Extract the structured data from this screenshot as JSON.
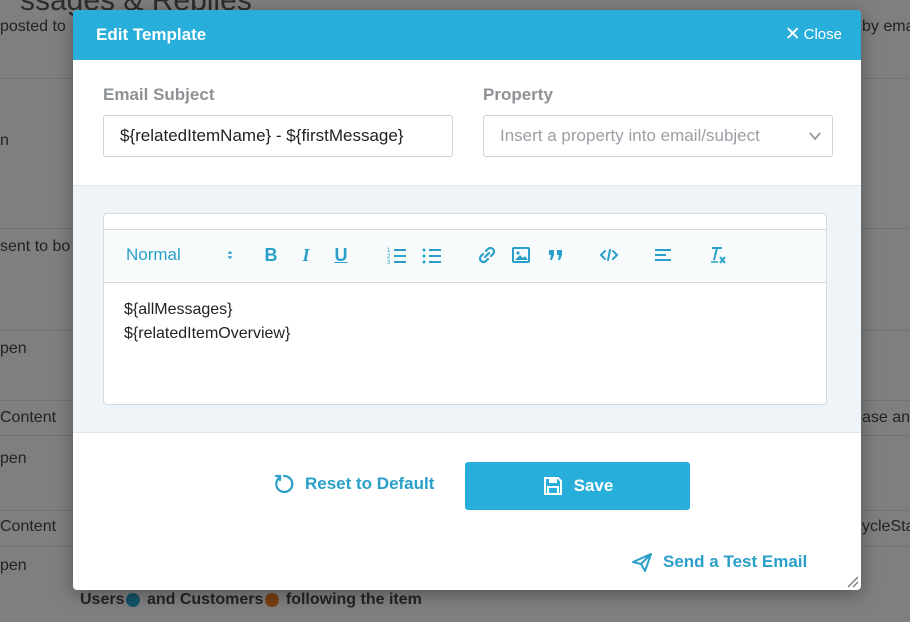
{
  "background": {
    "title": "ssages & Replies",
    "texts": [
      "posted to",
      "n",
      "sent to bo",
      "pen",
      "Content",
      "pen",
      "Content",
      "pen"
    ],
    "right_texts": [
      "by ema",
      "ase and",
      "ycleSta"
    ],
    "bottom": {
      "users": "Users",
      "customers": "and Customers",
      "suffix": "following the item"
    }
  },
  "modal": {
    "title": "Edit Template",
    "close_label": "Close",
    "subject": {
      "label": "Email Subject",
      "value": "${relatedItemName} - ${firstMessage}"
    },
    "property": {
      "label": "Property",
      "placeholder": "Insert a property into email/subject"
    },
    "toolbar": {
      "format": "Normal",
      "bold": "B",
      "italic": "I",
      "underline": "U"
    },
    "body_lines": [
      "${allMessages}",
      "${relatedItemOverview}"
    ],
    "reset_label": "Reset to Default",
    "save_label": "Save",
    "test_label": "Send a Test Email"
  },
  "colors": {
    "accent": "#28aedb",
    "link": "#2a9fc9",
    "label": "#8e9296"
  },
  "icons": {
    "close": "close-icon",
    "chevron": "chevron-down-icon",
    "sort": "sort-arrows-icon",
    "ordered_list": "ordered-list-icon",
    "bullet_list": "bullet-list-icon",
    "link": "link-icon",
    "image": "image-icon",
    "quote": "quote-icon",
    "code": "code-icon",
    "align": "align-icon",
    "clear_format": "clear-format-icon",
    "reset": "reset-icon",
    "save": "save-icon",
    "send": "send-icon"
  }
}
